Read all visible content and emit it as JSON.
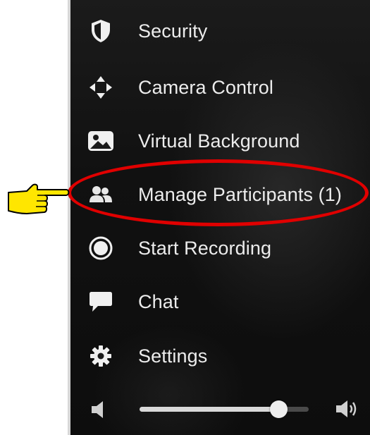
{
  "menu": {
    "items": [
      {
        "label": "Security",
        "icon": "shield-icon"
      },
      {
        "label": "Camera Control",
        "icon": "move-arrows-icon"
      },
      {
        "label": "Virtual Background",
        "icon": "image-icon"
      },
      {
        "label": "Manage Participants (1)",
        "icon": "participants-icon"
      },
      {
        "label": "Start Recording",
        "icon": "record-icon"
      },
      {
        "label": "Chat",
        "icon": "chat-bubble-icon"
      },
      {
        "label": "Settings",
        "icon": "gear-icon"
      }
    ]
  },
  "volume": {
    "level": 0.82,
    "low_icon": "speaker-low-icon",
    "high_icon": "speaker-high-icon"
  },
  "annotation": {
    "pointer_icon": "pointing-hand-icon",
    "highlight_color": "#e00000",
    "pointer_color": "#ffe600"
  },
  "colors": {
    "menu_text": "#ececec",
    "panel_bg": "#111111"
  }
}
